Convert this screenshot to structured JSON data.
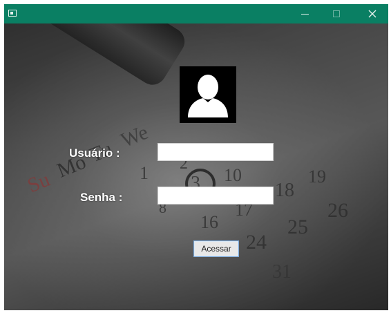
{
  "window": {
    "app_icon": "window-app-icon",
    "controls": {
      "minimize_icon": "minimize-icon",
      "maximize_icon": "maximize-icon",
      "close_icon": "close-icon"
    },
    "accent_color": "#0a7f63"
  },
  "background": {
    "description_icon": "calendar-photo",
    "weekdays": [
      "Su",
      "Mo",
      "Tu",
      "We"
    ],
    "dates": [
      "1",
      "2",
      "3",
      "8",
      "10",
      "16",
      "17",
      "18",
      "19",
      "24",
      "25",
      "26",
      "31"
    ]
  },
  "avatar": {
    "icon": "user-silhouette-icon"
  },
  "form": {
    "user_label": "Usuário :",
    "user_value": "",
    "password_label": "Senha :",
    "password_value": "",
    "submit_label": "Acessar"
  }
}
